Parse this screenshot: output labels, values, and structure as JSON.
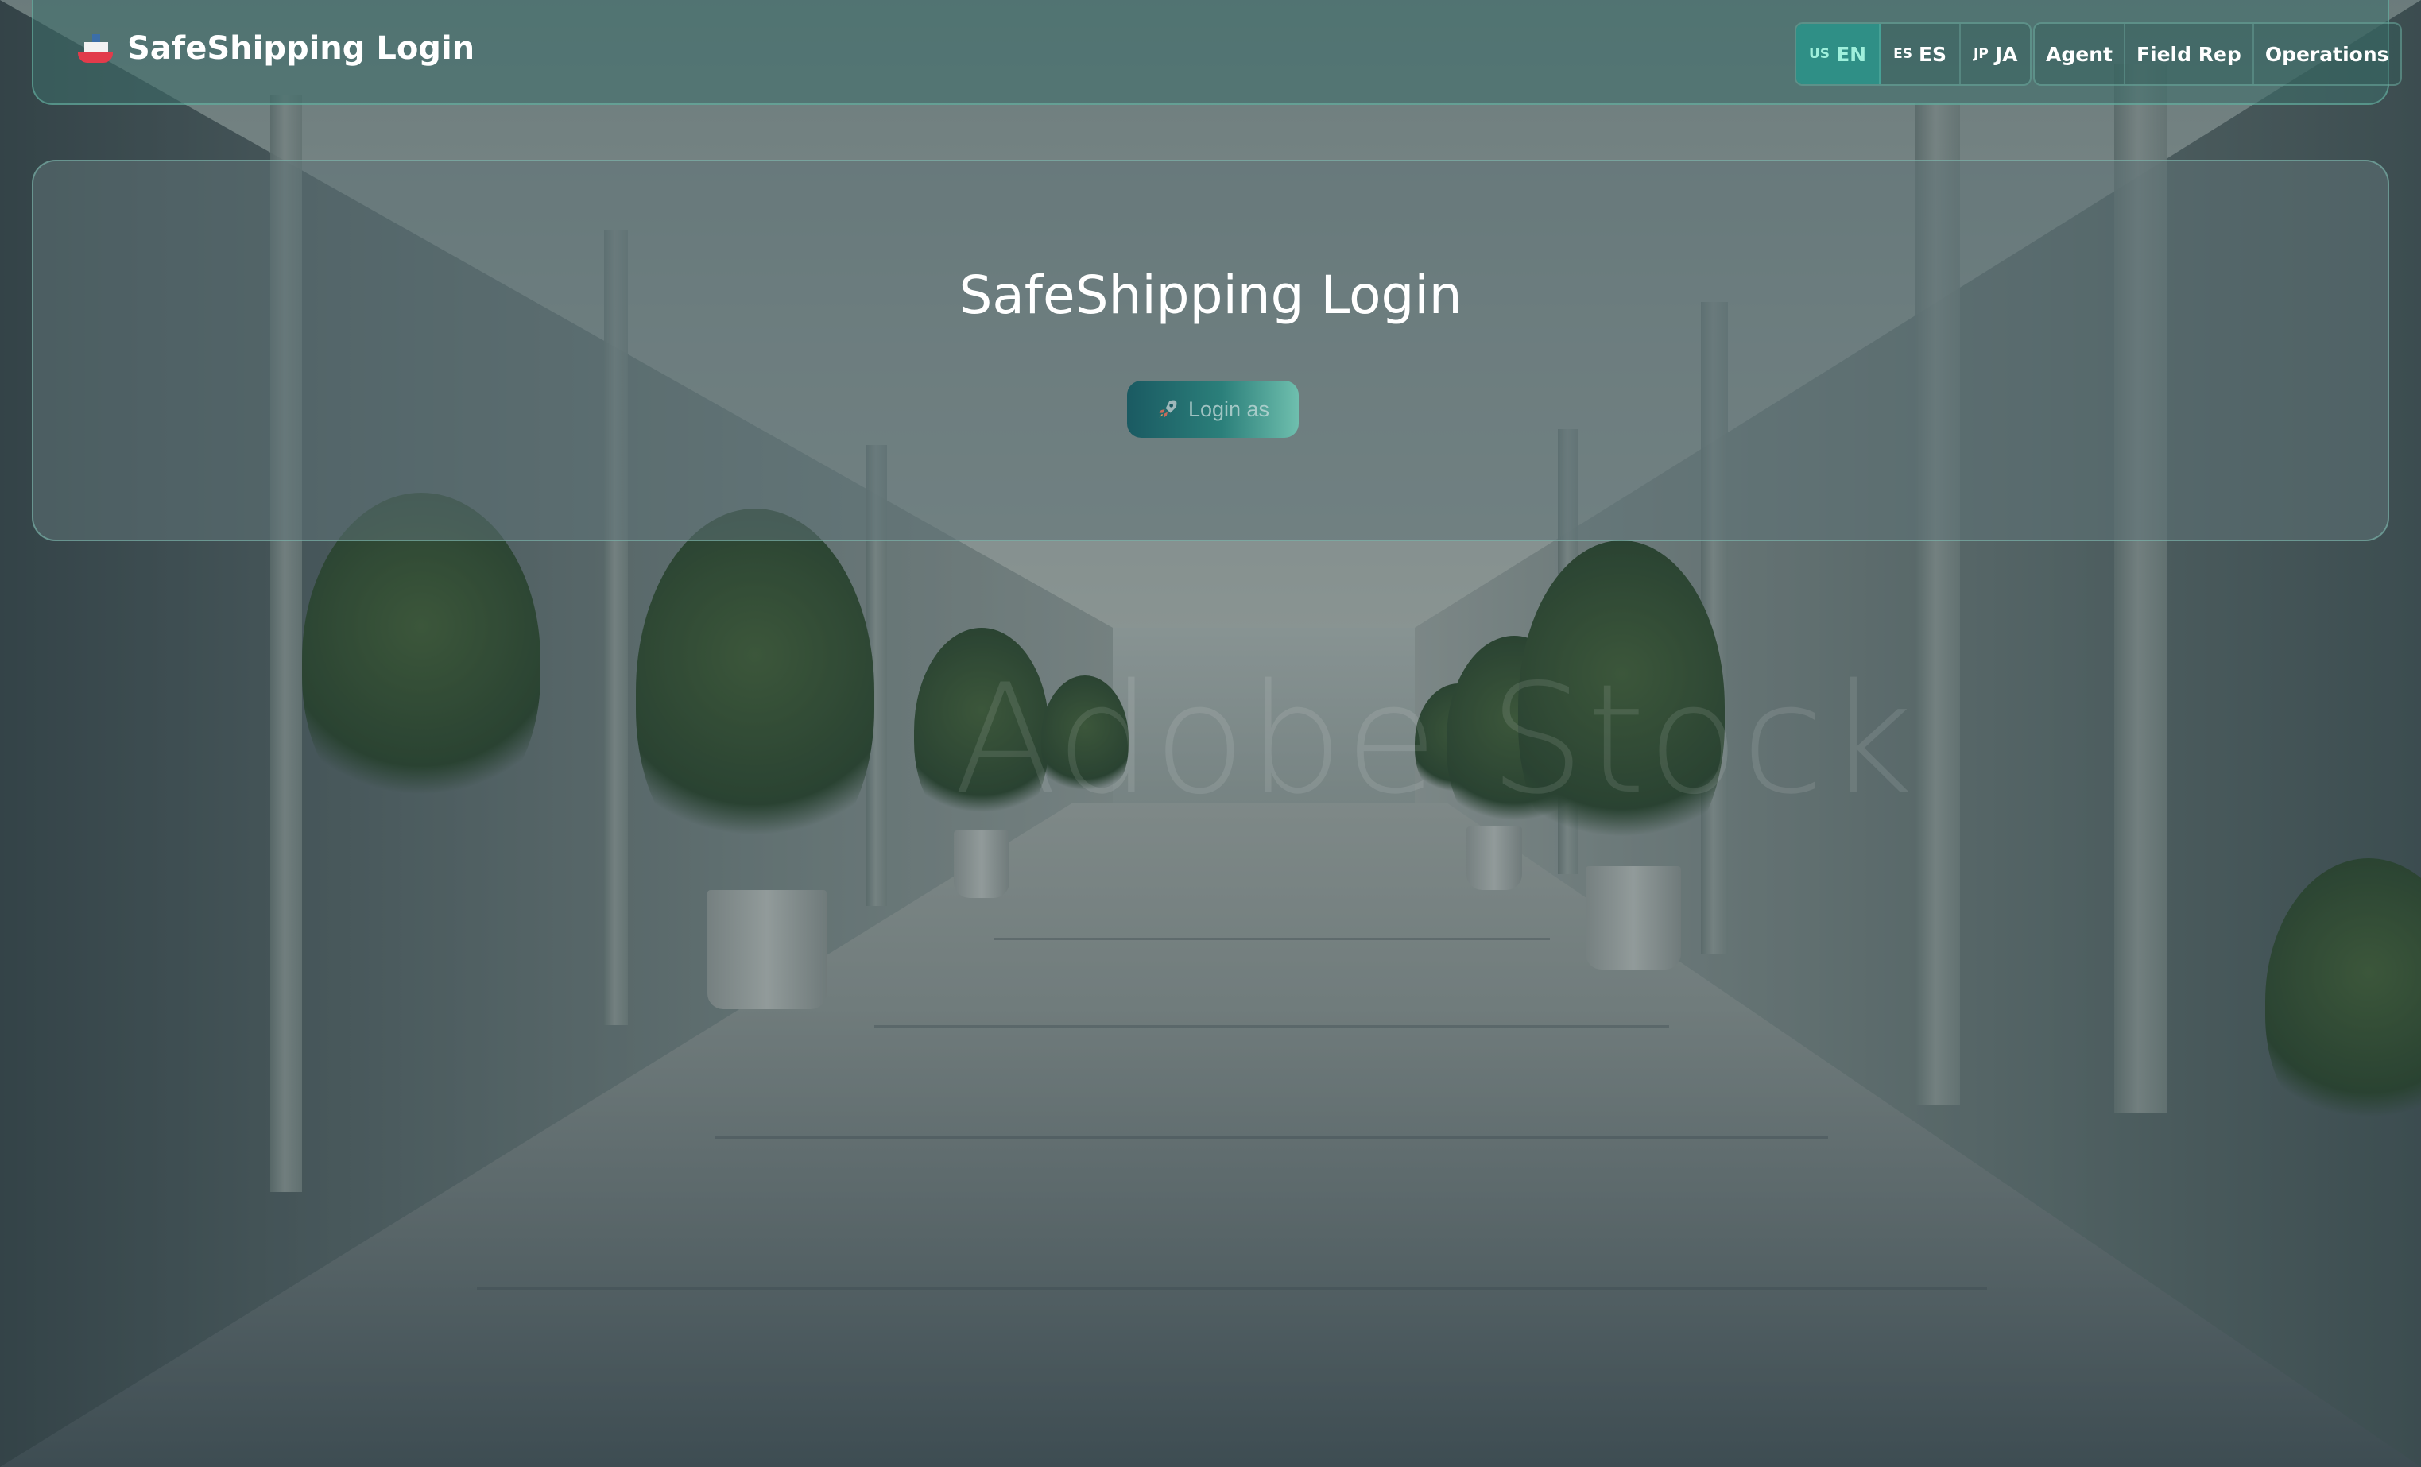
{
  "header": {
    "app_title": "SafeShipping Login",
    "brand_icon": "cruise-ship-icon"
  },
  "languages": [
    {
      "code": "US",
      "label": "EN",
      "active": true
    },
    {
      "code": "ES",
      "label": "ES",
      "active": false
    },
    {
      "code": "JP",
      "label": "JA",
      "active": false
    }
  ],
  "roles": [
    {
      "label": "Agent"
    },
    {
      "label": "Field Rep"
    },
    {
      "label": "Operations"
    }
  ],
  "main": {
    "title": "SafeShipping Login",
    "login_button": {
      "label": "Login as",
      "icon": "rocket-icon"
    }
  },
  "background": {
    "watermark": "Adobe Stock"
  },
  "colors": {
    "accent": "#2f8f86",
    "active_lang_text": "#9ff0dc",
    "brand_text": "#ffffff"
  }
}
